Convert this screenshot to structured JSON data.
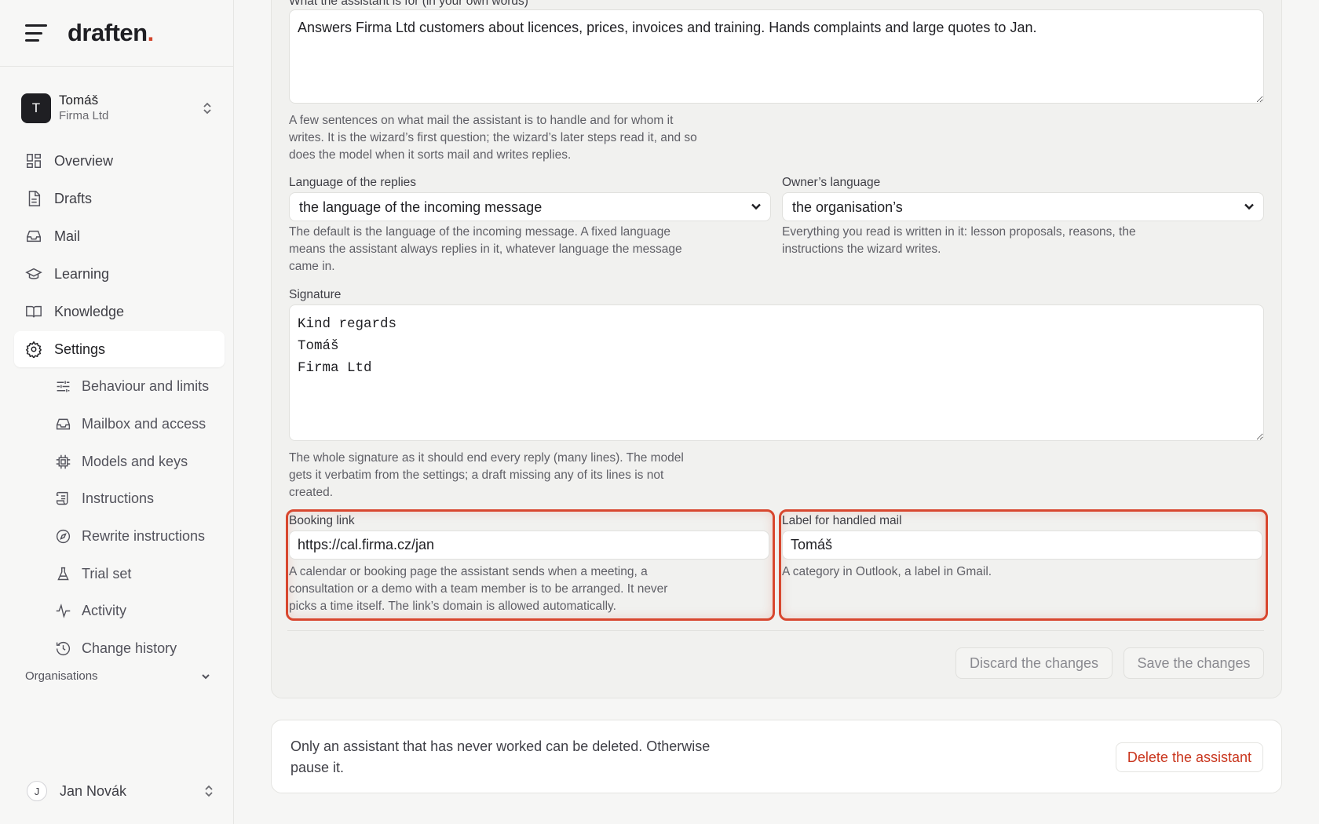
{
  "brand": {
    "name": "draften",
    "dot": "."
  },
  "account": {
    "initial": "T",
    "name": "Tomáš",
    "org": "Firma Ltd"
  },
  "nav": {
    "items": [
      {
        "label": "Overview",
        "icon": "grid-icon"
      },
      {
        "label": "Drafts",
        "icon": "document-icon"
      },
      {
        "label": "Mail",
        "icon": "inbox-icon"
      },
      {
        "label": "Learning",
        "icon": "graduation-cap-icon"
      },
      {
        "label": "Knowledge",
        "icon": "book-icon"
      },
      {
        "label": "Settings",
        "icon": "gear-icon",
        "active": true
      }
    ],
    "sub_items": [
      {
        "label": "Behaviour and limits",
        "icon": "sliders-icon"
      },
      {
        "label": "Mailbox and access",
        "icon": "inbox-icon"
      },
      {
        "label": "Models and keys",
        "icon": "chip-icon"
      },
      {
        "label": "Instructions",
        "icon": "scroll-icon"
      },
      {
        "label": "Rewrite instructions",
        "icon": "compass-icon"
      },
      {
        "label": "Trial set",
        "icon": "flask-icon"
      },
      {
        "label": "Activity",
        "icon": "activity-icon"
      },
      {
        "label": "Change history",
        "icon": "history-icon"
      }
    ]
  },
  "organisations": {
    "label": "Organisations"
  },
  "user": {
    "initial": "J",
    "name": "Jan Novák"
  },
  "form": {
    "purpose": {
      "label": "What the assistant is for (in your own words)",
      "value": "Answers Firma Ltd customers about licences, prices, invoices and training. Hands complaints and large quotes to Jan.",
      "help": "A few sentences on what mail the assistant is to handle and for whom it writes. It is the wizard’s first question; the wizard’s later steps read it, and so does the model when it sorts mail and writes replies."
    },
    "reply_language": {
      "label": "Language of the replies",
      "value": "the language of the incoming message",
      "help": "The default is the language of the incoming message. A fixed language means the assistant always replies in it, whatever language the message came in."
    },
    "owner_language": {
      "label": "Owner’s language",
      "value": "the organisation’s",
      "help": "Everything you read is written in it: lesson proposals, reasons, the instructions the wizard writes."
    },
    "signature": {
      "label": "Signature",
      "value": "Kind regards\nTomáš\nFirma Ltd",
      "help": "The whole signature as it should end every reply (many lines). The model gets it verbatim from the settings; a draft missing any of its lines is not created."
    },
    "booking_link": {
      "label": "Booking link",
      "value": "https://cal.firma.cz/jan",
      "help": "A calendar or booking page the assistant sends when a meeting, a consultation or a demo with a team member is to be arranged. It never picks a time itself. The link’s domain is allowed automatically."
    },
    "handled_label": {
      "label": "Label for handled mail",
      "value": "Tomáš",
      "help": "A category in Outlook, a label in Gmail."
    },
    "discard_label": "Discard the changes",
    "save_label": "Save the changes"
  },
  "danger": {
    "text": "Only an assistant that has never worked can be deleted. Otherwise pause it.",
    "delete_label": "Delete the assistant"
  },
  "colors": {
    "accent": "#d2452c",
    "highlight": "#d8472f",
    "danger_text": "#c9351d"
  }
}
